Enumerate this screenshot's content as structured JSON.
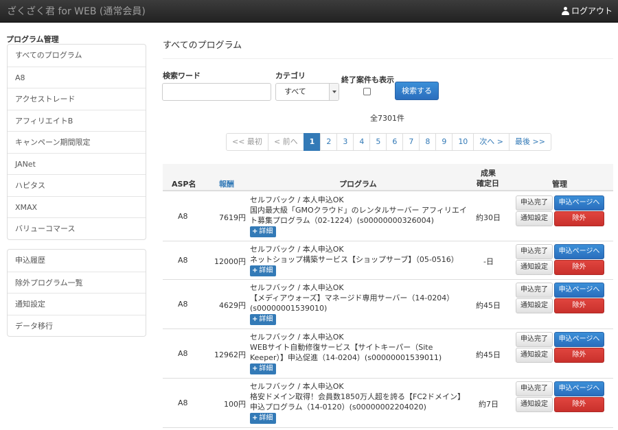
{
  "navbar": {
    "brand": "ざくざく君 for WEB (通常会員)",
    "logout": "ログアウト"
  },
  "sidebar": {
    "heading": "プログラム管理",
    "group1": [
      "すべてのプログラム",
      "A8",
      "アクセストレード",
      "アフィリエイトB",
      "キャンペーン期間限定",
      "JANet",
      "ハピタス",
      "XMAX",
      "バリューコマース"
    ],
    "group2": [
      "申込履歴",
      "除外プログラム一覧",
      "通知設定",
      "データ移行"
    ]
  },
  "main": {
    "title": "すべてのプログラム",
    "search": {
      "keyword_label": "検索ワード",
      "keyword_value": "",
      "category_label": "カテゴリ",
      "category_value": "すべて",
      "include_ended_label": "終了案件も表示",
      "include_ended_checked": false,
      "button": "検索する"
    },
    "total": "全7301件",
    "pagination": [
      "<< 最初",
      "< 前へ",
      "1",
      "2",
      "3",
      "4",
      "5",
      "6",
      "7",
      "8",
      "9",
      "10",
      "次へ >",
      "最後 >>"
    ],
    "pagination_active": "1",
    "pagination_disabled": [
      "<< 最初",
      "< 前へ"
    ]
  },
  "table": {
    "headers": {
      "asp": "ASP名",
      "reward": "報酬",
      "program": "プログラム",
      "confirm_line1": "成果",
      "confirm_line2": "確定日",
      "manage": "管理"
    },
    "detail_label": "詳細",
    "buttons": {
      "applied": "申込完了",
      "notify": "通知設定",
      "apply_page": "申込ページへ",
      "exclude": "除外"
    },
    "rows": [
      {
        "asp": "A8",
        "reward": "7619円",
        "program_line1": "セルフバック / 本人申込OK",
        "program_desc": "国内最大級「GMOクラウド」のレンタルサーバー アフィリエイト募集プログラム（02-1224）(s00000000326004)",
        "confirm": "約30日"
      },
      {
        "asp": "A8",
        "reward": "12000円",
        "program_line1": "セルフバック / 本人申込OK",
        "program_desc": "ネットショップ構築サービス【ショップサーブ】（05-0516）",
        "confirm": "-日"
      },
      {
        "asp": "A8",
        "reward": "4629円",
        "program_line1": "セルフバック / 本人申込OK",
        "program_desc": "【メディアウォーズ】マネージド専用サーバー（14-0204）(s00000001539010)",
        "confirm": "約45日"
      },
      {
        "asp": "A8",
        "reward": "12962円",
        "program_line1": "セルフバック / 本人申込OK",
        "program_desc": "WEBサイト自動修復サービス【サイトキーパー（Site Keeper）】申込促進（14-0204）(s00000001539011)",
        "confirm": "約45日"
      },
      {
        "asp": "A8",
        "reward": "100円",
        "program_line1": "セルフバック / 本人申込OK",
        "program_desc": "格安ドメイン取得！会員数1850万人超を誇る【FC2ドメイン】申込プログラム（14-0120）(s00000002204020)",
        "confirm": "約7日"
      }
    ]
  }
}
